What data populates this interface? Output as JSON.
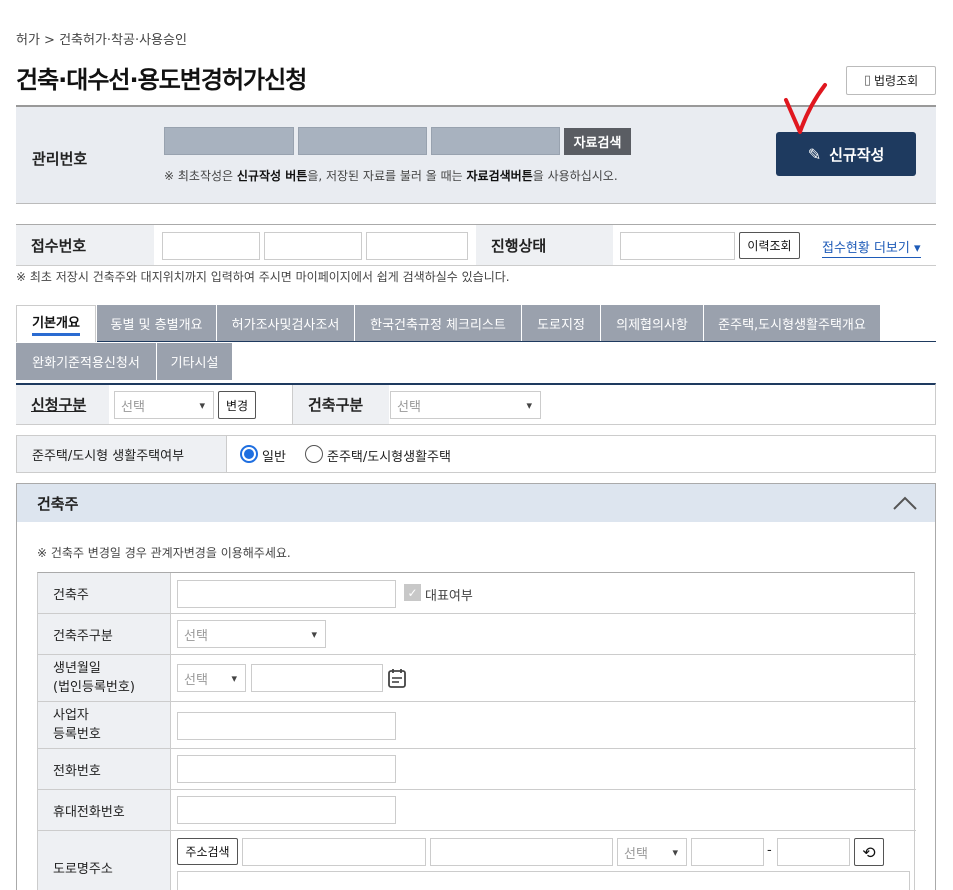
{
  "breadcrumb": "허가 > 건축허가·착공·사용승인",
  "title": "건축·대수선·용도변경허가신청",
  "law_button": "법령조회",
  "mgmt": {
    "label": "관리번호",
    "search_button": "자료검색",
    "note_prefix": "※ 최초작성은 ",
    "note_b1": "신규작성 버튼",
    "note_mid": "을, 저장된 자료를 불러 올 때는 ",
    "note_b2": "자료검색버튼",
    "note_suffix": "을 사용하십시오.",
    "new_button": "신규작성"
  },
  "receipt": {
    "label": "접수번호",
    "status_label": "진행상태",
    "history_button": "이력조회",
    "more_link": "접수현황 더보기"
  },
  "note2": "※ 최초 저장시 건축주와 대지위치까지 입력하여 주시면 마이페이지에서 쉽게 검색하실수 있습니다.",
  "tabs": [
    "기본개요",
    "동별 및 층별개요",
    "허가조사및검사조서",
    "한국건축규정 체크리스트",
    "도로지정",
    "의제협의사항",
    "준주택,도시형생활주택개요",
    "완화기준적용신청서",
    "기타시설"
  ],
  "apply": {
    "label": "신청구분",
    "select": "선택",
    "change_button": "변경",
    "build_label": "건축구분",
    "build_select": "선택"
  },
  "housing": {
    "label": "준주택/도시형 생활주택여부",
    "opt1": "일반",
    "opt2": "준주택/도시형생활주택"
  },
  "owner": {
    "title": "건축주",
    "note": "※ 건축주 변경일 경우 관계자변경을 이용해주세요.",
    "rows": {
      "owner": "건축주",
      "rep": "대표여부",
      "type": "건축주구분",
      "type_select": "선택",
      "birth1": "생년월일",
      "birth2": "(법인등록번호)",
      "birth_select": "선택",
      "biz1": "사업자",
      "biz2": "등록번호",
      "phone": "전화번호",
      "mobile": "휴대전화번호",
      "road": "도로명주소",
      "addr_button": "주소검색",
      "addr_select": "선택",
      "dash": "-"
    }
  }
}
